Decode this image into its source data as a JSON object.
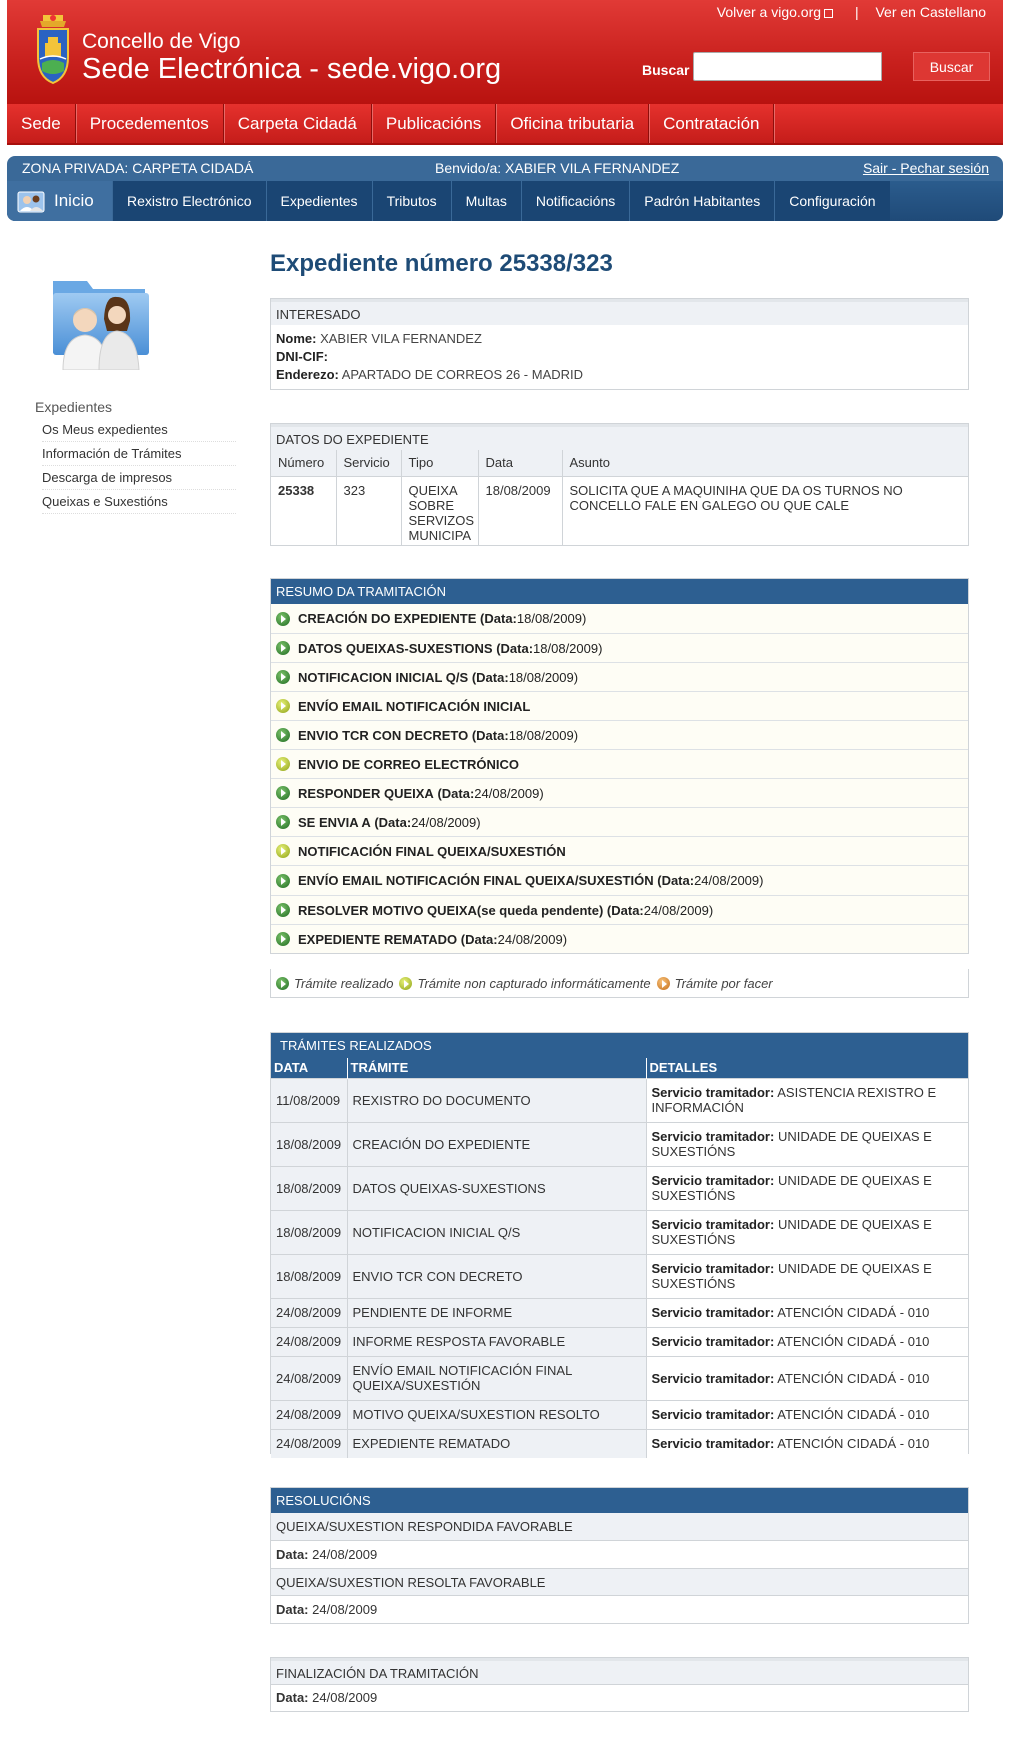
{
  "header": {
    "title_line1": "Concello de Vigo",
    "title_line2": "Sede Electrónica - sede.vigo.org",
    "toplink_back": "Volver a vigo.org",
    "toplink_separator": "|",
    "toplink_language": "Ver en Castellano",
    "search_label": "Buscar",
    "search_placeholder": "",
    "search_button": "Buscar"
  },
  "main_nav": [
    "Sede",
    "Procedementos",
    "Carpeta Cidadá",
    "Publicacións",
    "Oficina tributaria",
    "Contratación"
  ],
  "private_zone": {
    "label": "ZONA PRIVADA: CARPETA CIDADÁ",
    "welcome": "Benvido/a: XABIER VILA FERNANDEZ",
    "logout": "Sair - Pechar sesión",
    "inicio": "Inicio",
    "nav": [
      "Rexistro Electrónico",
      "Expedientes",
      "Tributos",
      "Multas",
      "Notificacións",
      "Padrón Habitantes",
      "Configuración"
    ]
  },
  "sidebar": {
    "title": "Expedientes",
    "items": [
      "Os Meus expedientes",
      "Información de Trámites",
      "Descarga de impresos",
      "Queixas e Suxestións"
    ]
  },
  "page_title": "Expediente número 25338/323",
  "interesado": {
    "heading": "INTERESADO",
    "nome_label": "Nome:",
    "nome_value": "XABIER VILA FERNANDEZ",
    "dni_label": "DNI-CIF:",
    "dni_value": "",
    "enderezo_label": "Enderezo:",
    "enderezo_value": "APARTADO DE CORREOS 26 - MADRID"
  },
  "datos": {
    "heading": "DATOS DO EXPEDIENTE",
    "columns": [
      "Número",
      "Servicio",
      "Tipo",
      "Data",
      "Asunto"
    ],
    "row": {
      "numero": "25338",
      "servicio": "323",
      "tipo": "QUEIXA SOBRE SERVIZOS MUNICIPA",
      "data": "18/08/2009",
      "asunto": "SOLICITA QUE A MAQUINIHA QUE DA OS TURNOS NO CONCELLO FALE EN GALEGO OU QUE CALE"
    }
  },
  "resumo": {
    "heading": "RESUMO DA TRAMITACIÓN",
    "date_label": "(Data:",
    "items": [
      {
        "name": "CREACIÓN DO EXPEDIENTE",
        "date": "18/08/2009",
        "status": "green"
      },
      {
        "name": "DATOS QUEIXAS-SUXESTIONS",
        "date": "18/08/2009",
        "status": "green"
      },
      {
        "name": "NOTIFICACION INICIAL Q/S",
        "date": "18/08/2009",
        "status": "green"
      },
      {
        "name": "ENVÍO EMAIL NOTIFICACIÓN INICIAL",
        "date": "",
        "status": "yellow"
      },
      {
        "name": "ENVIO TCR CON DECRETO",
        "date": "18/08/2009",
        "status": "green"
      },
      {
        "name": "ENVIO DE CORREO ELECTRÓNICO",
        "date": "",
        "status": "yellow"
      },
      {
        "name": "RESPONDER QUEIXA",
        "date": "24/08/2009",
        "status": "green"
      },
      {
        "name": "SE ENVIA A",
        "date": "24/08/2009",
        "status": "green"
      },
      {
        "name": "NOTIFICACIÓN FINAL QUEIXA/SUXESTIÓN",
        "date": "",
        "status": "yellow"
      },
      {
        "name": "ENVÍO EMAIL NOTIFICACIÓN FINAL QUEIXA/SUXESTIÓN",
        "date": "24/08/2009",
        "status": "green"
      },
      {
        "name": "RESOLVER MOTIVO QUEIXA(se queda pendente)",
        "date": "24/08/2009",
        "status": "green"
      },
      {
        "name": "EXPEDIENTE REMATADO",
        "date": "24/08/2009",
        "status": "green"
      }
    ]
  },
  "legend": {
    "done": "Trámite realizado",
    "not_captured": "Trámite non capturado informáticamente",
    "pending": "Trámite por facer"
  },
  "tramites": {
    "heading": "TRÁMITES REALIZADOS",
    "columns": [
      "DATA",
      "TRÁMITE",
      "DETALLES"
    ],
    "service_label": "Servicio tramitador:",
    "rows": [
      {
        "data": "11/08/2009",
        "tramite": "REXISTRO DO DOCUMENTO",
        "servicio": "ASISTENCIA REXISTRO E INFORMACIÓN"
      },
      {
        "data": "18/08/2009",
        "tramite": "CREACIÓN DO EXPEDIENTE",
        "servicio": "UNIDADE DE QUEIXAS E SUXESTIÓNS"
      },
      {
        "data": "18/08/2009",
        "tramite": "DATOS QUEIXAS-SUXESTIONS",
        "servicio": "UNIDADE DE QUEIXAS E SUXESTIÓNS"
      },
      {
        "data": "18/08/2009",
        "tramite": "NOTIFICACION INICIAL Q/S",
        "servicio": "UNIDADE DE QUEIXAS E SUXESTIÓNS"
      },
      {
        "data": "18/08/2009",
        "tramite": "ENVIO TCR CON DECRETO",
        "servicio": "UNIDADE DE QUEIXAS E SUXESTIÓNS"
      },
      {
        "data": "24/08/2009",
        "tramite": "PENDIENTE DE INFORME",
        "servicio": "ATENCIÓN CIDADÁ - 010"
      },
      {
        "data": "24/08/2009",
        "tramite": "INFORME RESPOSTA FAVORABLE",
        "servicio": "ATENCIÓN CIDADÁ - 010"
      },
      {
        "data": "24/08/2009",
        "tramite": "ENVÍO EMAIL NOTIFICACIÓN FINAL QUEIXA/SUXESTIÓN",
        "servicio": "ATENCIÓN CIDADÁ - 010"
      },
      {
        "data": "24/08/2009",
        "tramite": "MOTIVO QUEIXA/SUXESTION RESOLTO",
        "servicio": "ATENCIÓN CIDADÁ - 010"
      },
      {
        "data": "24/08/2009",
        "tramite": "EXPEDIENTE REMATADO",
        "servicio": "ATENCIÓN CIDADÁ - 010"
      }
    ]
  },
  "resolucions": {
    "heading": "RESOLUCIÓNS",
    "data_label": "Data:",
    "items": [
      {
        "title": "QUEIXA/SUXESTION RESPONDIDA FAVORABLE",
        "data": "24/08/2009"
      },
      {
        "title": "QUEIXA/SUXESTION RESOLTA FAVORABLE",
        "data": "24/08/2009"
      }
    ]
  },
  "finalizacion": {
    "heading": "FINALIZACIÓN DA TRAMITACIÓN",
    "data_label": "Data:",
    "data": "24/08/2009"
  },
  "colors": {
    "header_red": "#c8201d",
    "nav_blue": "#2d5f91",
    "title_blue": "#1e4b76",
    "status_done": "#2e7d32",
    "status_not_captured": "#9bb21d",
    "status_pending": "#d97c1c"
  }
}
